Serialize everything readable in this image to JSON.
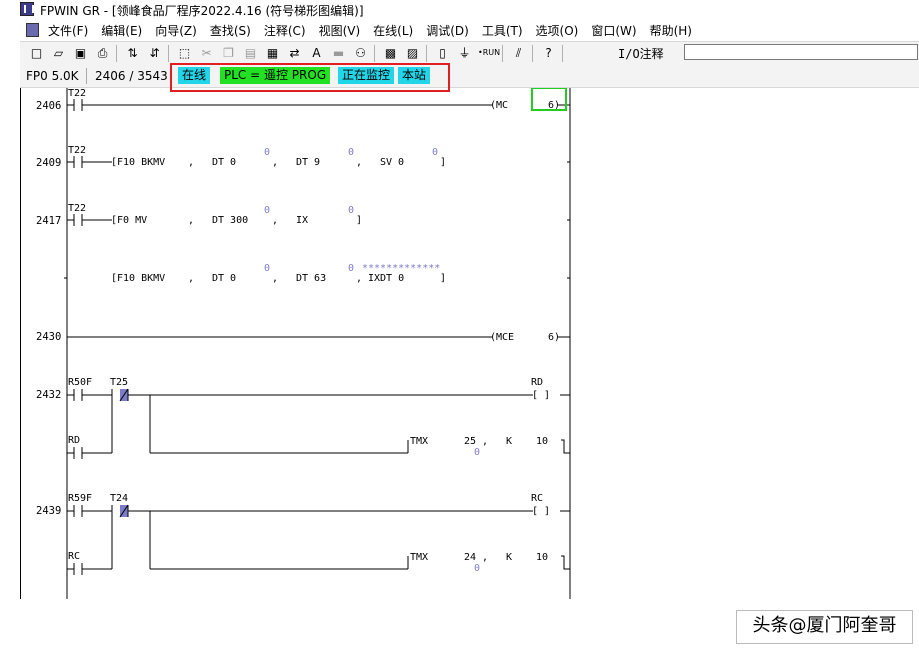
{
  "window": {
    "title": "FPWIN GR - [领峰食品厂程序2022.4.16 (符号梯形图编辑)]"
  },
  "menu": [
    "文件(F)",
    "编辑(E)",
    "向导(Z)",
    "查找(S)",
    "注释(C)",
    "视图(V)",
    "在线(L)",
    "调试(D)",
    "工具(T)",
    "选项(O)",
    "窗口(W)",
    "帮助(H)"
  ],
  "toolbar": {
    "io_label": "I/O注释",
    "io_value": ""
  },
  "status": {
    "plc_type": "FP0 5.0K",
    "step": "2406 / 3543",
    "online": "在线",
    "plc_mode": "PLC = 遥控 PROG",
    "monitoring": "正在监控",
    "station": "本站"
  },
  "colors": {
    "online_badge": "#21d6e8",
    "plc_badge": "#22e022",
    "highlight_box": "#e02020",
    "cursor_box": "#22cc22",
    "monitor_value": "#7c7cc8"
  },
  "ladder": {
    "rows": [
      {
        "step": "2406",
        "contacts": [
          "T22"
        ],
        "output": "(MC",
        "args": [
          "6)"
        ]
      },
      {
        "step": "2409",
        "contacts": [
          "T22"
        ],
        "instruction": "[F10 BKMV",
        "operands": [
          "DT 0",
          "DT 9",
          "SV 0"
        ],
        "values": [
          "0",
          "0",
          "0"
        ]
      },
      {
        "step": "2417",
        "contacts": [
          "T22"
        ],
        "instruction": "[F0 MV",
        "operands": [
          "DT 300",
          "IX"
        ],
        "values": [
          "0",
          "0"
        ]
      },
      {
        "step": "",
        "instruction": "[F10 BKMV",
        "operands": [
          "DT 0",
          "DT 63",
          "IXDT 0"
        ],
        "values": [
          "0",
          "0"
        ],
        "mask": "*************"
      },
      {
        "step": "2430",
        "output": "(MCE",
        "args": [
          "6)"
        ]
      },
      {
        "step": "2432",
        "contacts": [
          "R50F",
          "T25"
        ],
        "coil": "RD",
        "branch_contact": "RD",
        "timer": "TMX",
        "timer_no": "25",
        "k_label": "K",
        "k_value": "10",
        "timer_monitor": "0"
      },
      {
        "step": "2439",
        "contacts": [
          "R59F",
          "T24"
        ],
        "coil": "RC",
        "branch_contact": "RC",
        "timer": "TMX",
        "timer_no": "24",
        "k_label": "K",
        "k_value": "10",
        "timer_monitor": "0"
      }
    ]
  },
  "watermark": "头条@厦门阿奎哥"
}
